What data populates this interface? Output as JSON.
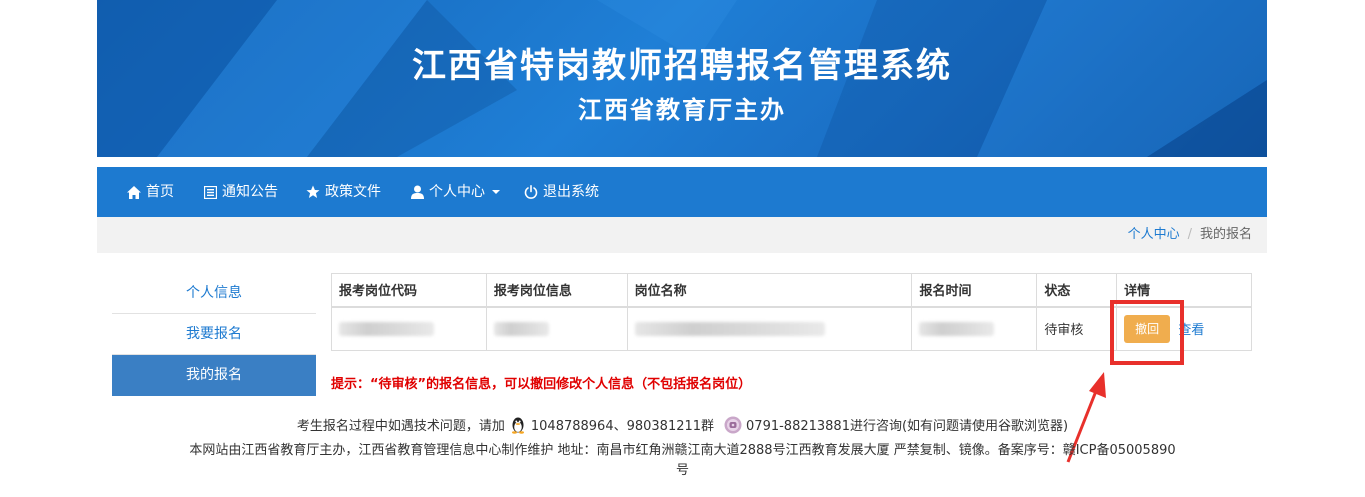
{
  "banner": {
    "title": "江西省特岗教师招聘报名管理系统",
    "subtitle": "江西省教育厅主办"
  },
  "nav": {
    "home": "首页",
    "notice": "通知公告",
    "policy": "政策文件",
    "personal_center": "个人中心",
    "logout": "退出系统"
  },
  "breadcrumb": {
    "parent": "个人中心",
    "separator": "/",
    "current": "我的报名"
  },
  "side_menu": {
    "items": [
      {
        "label": "个人信息",
        "active": false
      },
      {
        "label": "我要报名",
        "active": false
      },
      {
        "label": "我的报名",
        "active": true
      }
    ]
  },
  "table": {
    "headers": [
      "报考岗位代码",
      "报考岗位信息",
      "岗位名称",
      "报名时间",
      "状态",
      "详情"
    ],
    "row": {
      "status": "待审核",
      "withdraw_label": "撤回",
      "view_label": "查看"
    }
  },
  "hint": "提示：“待审核”的报名信息，可以撤回修改个人信息（不包括报名岗位）",
  "footer": {
    "line1_prefix": "考生报名过程中如遇技术问题，请加",
    "line1_qq": "1048788964、980381211群",
    "line1_phone": "0791-88213881进行咨询(如有问题请使用谷歌浏览器)",
    "line2": "本网站由江西省教育厅主办，江西省教育管理信息中心制作维护 地址：南昌市红角洲赣江南大道2888号江西教育发展大厦 严禁复制、镜像。备案序号：赣ICP备05005890号"
  },
  "colors": {
    "primary": "#1d7ad0",
    "active_side": "#3a7fc4",
    "warning_button": "#f0ad4e",
    "hint_red": "#e00000",
    "annotation_red": "#e8302b"
  }
}
